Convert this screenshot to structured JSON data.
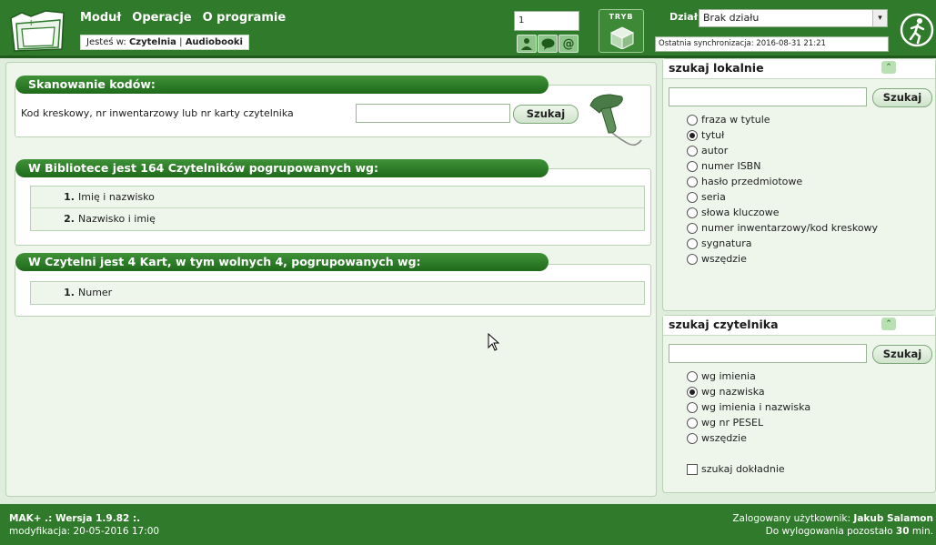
{
  "menu": [
    "Moduł",
    "Operacje",
    "O programie"
  ],
  "context": {
    "prefix": "Jesteś w:",
    "section": "Czytelnia",
    "sep": "|",
    "subsection": "Audiobooki"
  },
  "header": {
    "number_value": "1",
    "tryb_label": "TRYB",
    "dzial_label": "Dział:",
    "dzial_value": "Brak działu",
    "sync_text": "Ostatnia synchronizacja: 2016-08-31 21:21"
  },
  "scan": {
    "title": "Skanowanie kodów:",
    "label": "Kod kreskowy, nr inwentarzowy lub nr karty czytelnika",
    "input_value": "",
    "button": "Szukaj"
  },
  "readers": {
    "title": "W Bibliotece jest 164 Czytelników pogrupowanych wg:",
    "items": [
      {
        "num": "1.",
        "label": "Imię i nazwisko"
      },
      {
        "num": "2.",
        "label": "Nazwisko i imię"
      }
    ]
  },
  "cards": {
    "title": "W Czytelni jest 4 Kart, w tym wolnych 4, pogrupowanych wg:",
    "items": [
      {
        "num": "1.",
        "label": "Numer"
      }
    ]
  },
  "local_search": {
    "title": "szukaj lokalnie",
    "collapse_glyph": "⌃",
    "input_value": "",
    "button": "Szukaj",
    "options": [
      {
        "label": "fraza w tytule",
        "checked": false
      },
      {
        "label": "tytuł",
        "checked": true
      },
      {
        "label": "autor",
        "checked": false
      },
      {
        "label": "numer ISBN",
        "checked": false
      },
      {
        "label": "hasło przedmiotowe",
        "checked": false
      },
      {
        "label": "seria",
        "checked": false
      },
      {
        "label": "słowa kluczowe",
        "checked": false
      },
      {
        "label": "numer inwentarzowy/kod kreskowy",
        "checked": false
      },
      {
        "label": "sygnatura",
        "checked": false
      },
      {
        "label": "wszędzie",
        "checked": false
      }
    ]
  },
  "reader_search": {
    "title": "szukaj czytelnika",
    "collapse_glyph": "⌃",
    "input_value": "",
    "button": "Szukaj",
    "options": [
      {
        "label": "wg imienia",
        "checked": false
      },
      {
        "label": "wg nazwiska",
        "checked": true
      },
      {
        "label": "wg imienia i nazwiska",
        "checked": false
      },
      {
        "label": "wg nr PESEL",
        "checked": false
      },
      {
        "label": "wszędzie",
        "checked": false
      }
    ],
    "exact_label": "szukaj dokładnie",
    "exact_checked": false
  },
  "footer": {
    "version_prefix": "MAK+ .: Wersja 1.9.82 :.",
    "modified": "modyfikacja: 20-05-2016 17:00",
    "user_label": "Zalogowany użytkownik:",
    "user_name": "Jakub Salamon",
    "logout_prefix": "Do wylogowania pozostało",
    "logout_value": "30",
    "logout_unit": "min."
  },
  "colors": {
    "header_green": "#2f7a2b",
    "panel_bg": "#eef6ec",
    "title_green": "#1f6a1b"
  }
}
